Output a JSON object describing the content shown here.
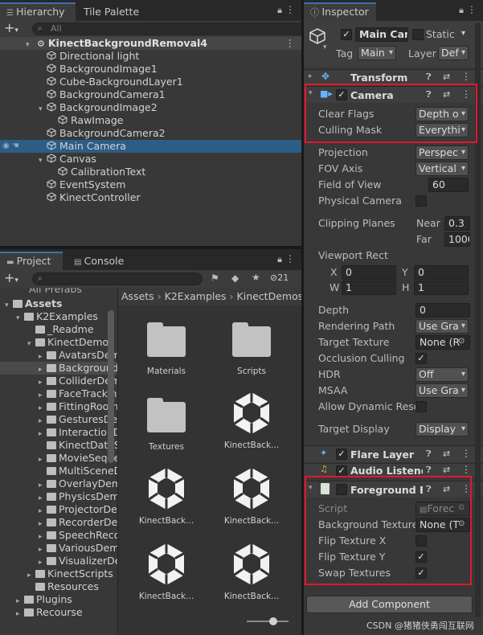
{
  "hierarchy": {
    "tab_label": "Hierarchy",
    "tab2_label": "Tile Palette",
    "search_placeholder": "All",
    "add_label": "+",
    "scene_name": "KinectBackgroundRemoval4",
    "items": [
      {
        "label": "Directional light",
        "level": 1,
        "expand": ""
      },
      {
        "label": "BackgroundImage1",
        "level": 1,
        "expand": ""
      },
      {
        "label": "Cube-BackgroundLayer1",
        "level": 1,
        "expand": ""
      },
      {
        "label": "BackgroundCamera1",
        "level": 1,
        "expand": ""
      },
      {
        "label": "BackgroundImage2",
        "level": 1,
        "expand": "▾"
      },
      {
        "label": "RawImage",
        "level": 2,
        "expand": ""
      },
      {
        "label": "BackgroundCamera2",
        "level": 1,
        "expand": ""
      },
      {
        "label": "Main Camera",
        "level": 1,
        "expand": "",
        "selected": true
      },
      {
        "label": "Canvas",
        "level": 1,
        "expand": "▾"
      },
      {
        "label": "CalibrationText",
        "level": 2,
        "expand": ""
      },
      {
        "label": "EventSystem",
        "level": 1,
        "expand": ""
      },
      {
        "label": "KinectController",
        "level": 1,
        "expand": ""
      }
    ]
  },
  "project": {
    "tab_label": "Project",
    "console_label": "Console",
    "add_label": "+",
    "count_label": "21",
    "tree_top_partial": "All Prefabs",
    "tree": [
      {
        "label": "Assets",
        "level": 0,
        "expand": "▾",
        "bold": true
      },
      {
        "label": "K2Examples",
        "level": 1,
        "expand": "▾"
      },
      {
        "label": "_Readme",
        "level": 2,
        "expand": ""
      },
      {
        "label": "KinectDemos",
        "level": 2,
        "expand": "▾"
      },
      {
        "label": "AvatarsDemo",
        "level": 3,
        "expand": "▸"
      },
      {
        "label": "BackgroundRemovalDemo",
        "level": 3,
        "expand": "▸",
        "selected": true
      },
      {
        "label": "ColliderDemo",
        "level": 3,
        "expand": "▸"
      },
      {
        "label": "FaceTrackingDemo",
        "level": 3,
        "expand": "▸"
      },
      {
        "label": "FittingRoomDemo",
        "level": 3,
        "expand": "▸"
      },
      {
        "label": "GesturesDemo",
        "level": 3,
        "expand": "▸"
      },
      {
        "label": "InteractionDemo",
        "level": 3,
        "expand": "▸"
      },
      {
        "label": "KinectDataServer",
        "level": 3,
        "expand": ""
      },
      {
        "label": "MovieSequenceDemo",
        "level": 3,
        "expand": "▸"
      },
      {
        "label": "MultiSceneDemo",
        "level": 3,
        "expand": ""
      },
      {
        "label": "OverlayDemo",
        "level": 3,
        "expand": "▸"
      },
      {
        "label": "PhysicsDemo",
        "level": 3,
        "expand": "▸"
      },
      {
        "label": "ProjectorDemo",
        "level": 3,
        "expand": "▸"
      },
      {
        "label": "RecorderDemo",
        "level": 3,
        "expand": "▸"
      },
      {
        "label": "SpeechRecognitionDemo",
        "level": 3,
        "expand": "▸"
      },
      {
        "label": "VariousDemos",
        "level": 3,
        "expand": "▸"
      },
      {
        "label": "VisualizerDemo",
        "level": 3,
        "expand": "▸"
      },
      {
        "label": "KinectScripts",
        "level": 2,
        "expand": "▸"
      },
      {
        "label": "Resources",
        "level": 2,
        "expand": ""
      },
      {
        "label": "Plugins",
        "level": 1,
        "expand": "▸"
      },
      {
        "label": "Recourse",
        "level": 1,
        "expand": "▸"
      }
    ],
    "breadcrumb": [
      "Assets",
      "K2Examples",
      "KinectDemos"
    ],
    "assets": [
      {
        "label": "Materials",
        "kind": "folder"
      },
      {
        "label": "Scripts",
        "kind": "folder"
      },
      {
        "label": "Textures",
        "kind": "folder"
      },
      {
        "label": "KinectBack...",
        "kind": "unity"
      },
      {
        "label": "KinectBack...",
        "kind": "unity"
      },
      {
        "label": "KinectBack...",
        "kind": "unity"
      },
      {
        "label": "KinectBack...",
        "kind": "unity"
      },
      {
        "label": "KinectBack...",
        "kind": "unity"
      }
    ]
  },
  "inspector": {
    "tab_label": "Inspector",
    "object_name": "Main Cam",
    "static_label": "Static",
    "tag_label": "Tag",
    "tag_value": "Main",
    "layer_label": "Layer",
    "layer_value": "Def",
    "transform_title": "Transform",
    "camera_title": "Camera",
    "camera_fields": {
      "clear_flags_label": "Clear Flags",
      "clear_flags_value": "Depth o",
      "culling_mask_label": "Culling Mask",
      "culling_mask_value": "Everythi",
      "projection_label": "Projection",
      "projection_value": "Perspec",
      "fov_axis_label": "FOV Axis",
      "fov_axis_value": "Vertical",
      "fov_label": "Field of View",
      "fov_value": "60",
      "physical_label": "Physical Camera",
      "clipping_label": "Clipping Planes",
      "near_label": "Near",
      "near_value": "0.3",
      "far_label": "Far",
      "far_value": "1000",
      "viewport_label": "Viewport Rect",
      "x_label": "X",
      "x_value": "0",
      "y_label": "Y",
      "y_value": "0",
      "w_label": "W",
      "w_value": "1",
      "h_label": "H",
      "h_value": "1",
      "depth_label": "Depth",
      "depth_value": "0",
      "rendering_path_label": "Rendering Path",
      "rendering_path_value": "Use Gra",
      "target_texture_label": "Target Texture",
      "target_texture_value": "None (R",
      "occlusion_label": "Occlusion Culling",
      "hdr_label": "HDR",
      "hdr_value": "Off",
      "msaa_label": "MSAA",
      "msaa_value": "Use Gra",
      "dyn_res_label": "Allow Dynamic Reso",
      "target_display_label": "Target Display",
      "target_display_value": "Display"
    },
    "flare_title": "Flare Layer",
    "audio_title": "Audio Listene",
    "fg_title": "Foreground Bl",
    "fg_fields": {
      "script_label": "Script",
      "script_value": "Forec",
      "bg_texture_label": "Background Texture",
      "bg_texture_value": "None (T",
      "flip_x_label": "Flip Texture X",
      "flip_y_label": "Flip Texture Y",
      "swap_label": "Swap Textures"
    },
    "add_component_label": "Add Component"
  },
  "watermark": "CSDN @猪猪侠勇闯互联网",
  "colors": {
    "accent": "#3a72b0",
    "highlight_box": "#e3172e",
    "selected_row": "#2c5d87"
  }
}
